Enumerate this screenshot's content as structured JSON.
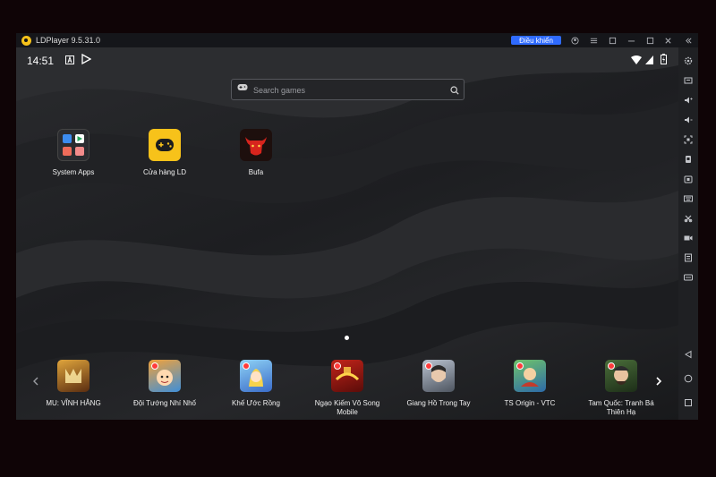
{
  "window": {
    "title": "LDPlayer 9.5.31.0",
    "control_label": "Điều khiển"
  },
  "status": {
    "time": "14:51"
  },
  "search": {
    "placeholder": "Search games"
  },
  "home_apps": [
    {
      "label": "System Apps"
    },
    {
      "label": "Cửa hàng LD"
    },
    {
      "label": "Bufa"
    }
  ],
  "dock_apps": [
    {
      "label": "MU: VĨNH HẰNG"
    },
    {
      "label": "Đội Tướng Nhí Nhố"
    },
    {
      "label": "Khế Ước Rồng"
    },
    {
      "label": "Ngạo Kiếm Vô Song Mobile"
    },
    {
      "label": "Giang Hồ Trong Tay"
    },
    {
      "label": "TS Origin - VTC"
    },
    {
      "label": "Tam Quốc: Tranh Bá Thiên Hạ"
    }
  ],
  "colors": {
    "accent": "#2f6bff",
    "store_yellow": "#f7c21a",
    "badge_red": "#ff3b3b"
  }
}
